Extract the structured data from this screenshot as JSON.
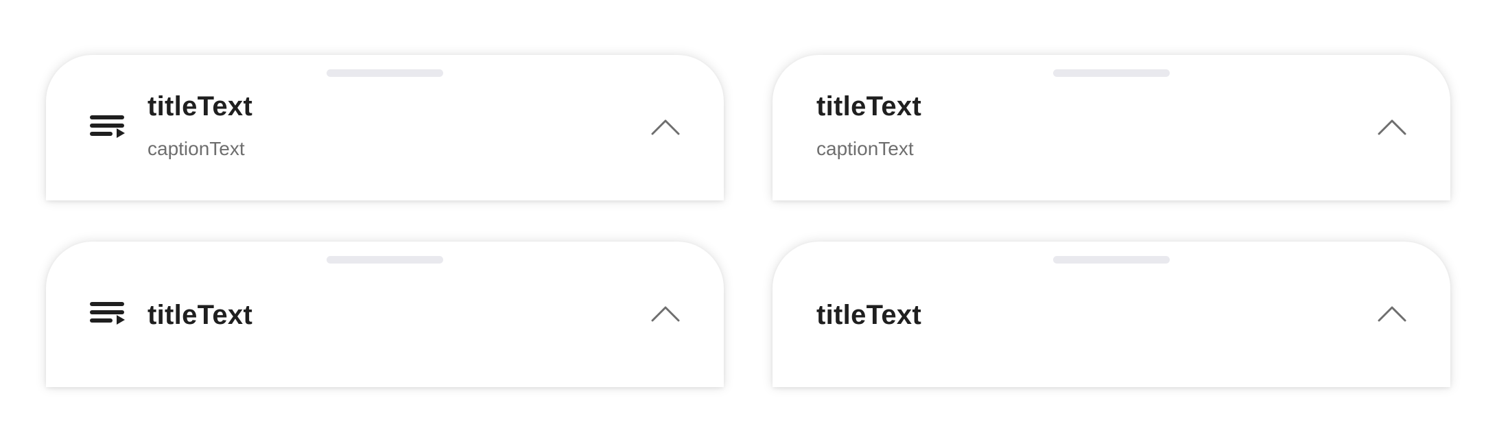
{
  "sheets": [
    {
      "title": "titleText",
      "caption": "captionText",
      "leading_icon": "playlist-play-icon",
      "trailing_icon": "chevron-up-icon"
    },
    {
      "title": "titleText",
      "caption": "captionText",
      "trailing_icon": "chevron-up-icon"
    },
    {
      "title": "titleText",
      "leading_icon": "playlist-play-icon",
      "trailing_icon": "chevron-up-icon"
    },
    {
      "title": "titleText",
      "trailing_icon": "chevron-up-icon"
    }
  ],
  "colors": {
    "surface": "#ffffff",
    "handle": "#e9e9ee",
    "title": "#1f1f1f",
    "caption": "#6e6e6e",
    "icon": "#1f1f1f",
    "chevron": "#6e6e6e"
  }
}
